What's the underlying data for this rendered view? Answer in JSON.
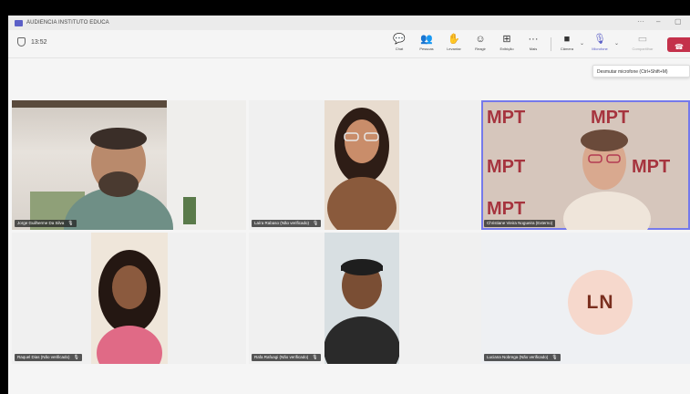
{
  "window": {
    "title": "AUDIENCIA INSTITUTO EDUCA",
    "controls": [
      "···",
      "–",
      "▢"
    ]
  },
  "meeting": {
    "elapsed": "13:52"
  },
  "toolbar": {
    "buttons": [
      {
        "id": "chat",
        "label": "Chat",
        "icon": "chat-icon",
        "glyph": "💬"
      },
      {
        "id": "people",
        "label": "Pessoas",
        "icon": "people-icon",
        "glyph": "👥"
      },
      {
        "id": "raise",
        "label": "Levantar",
        "icon": "raise-hand-icon",
        "glyph": "✋"
      },
      {
        "id": "react",
        "label": "Reagir",
        "icon": "react-icon",
        "glyph": "☺"
      },
      {
        "id": "view",
        "label": "Exibição",
        "icon": "layout-icon",
        "glyph": "⊞"
      },
      {
        "id": "more",
        "label": "Mais",
        "icon": "more-icon",
        "glyph": "···"
      },
      {
        "id": "camera",
        "label": "Câmera",
        "icon": "camera-icon",
        "glyph": "■"
      },
      {
        "id": "mic",
        "label": "Microfone",
        "icon": "microphone-icon",
        "glyph": "🎙"
      },
      {
        "id": "share",
        "label": "Compartilhar",
        "icon": "share-icon",
        "glyph": "▭"
      }
    ],
    "tooltip": "Desmutar microfone (Ctrl+Shift+M)"
  },
  "participants": [
    {
      "name": "Jorge Guilherme Da Silva",
      "muted": true
    },
    {
      "name": "Laíra Rabaso (Não verificado)",
      "muted": true
    },
    {
      "name": "Christiane Vieira Nogueira (Externo)",
      "muted": false,
      "speaking": true
    },
    {
      "name": "Raquel Dias (Não verificado)",
      "muted": true
    },
    {
      "name": "Rafa Rafuagi (Não verificado)",
      "muted": true
    },
    {
      "name": "Luciana Nobrega (Não verificado)",
      "muted": true,
      "initials": "LN"
    }
  ],
  "colors": {
    "accent": "#5b5fc7",
    "leave": "#c4314b",
    "mpt": "#a6343e",
    "avatar_bg": "#f6d8cc",
    "avatar_text": "#7a2e1e"
  },
  "mpt_text": "MPT"
}
